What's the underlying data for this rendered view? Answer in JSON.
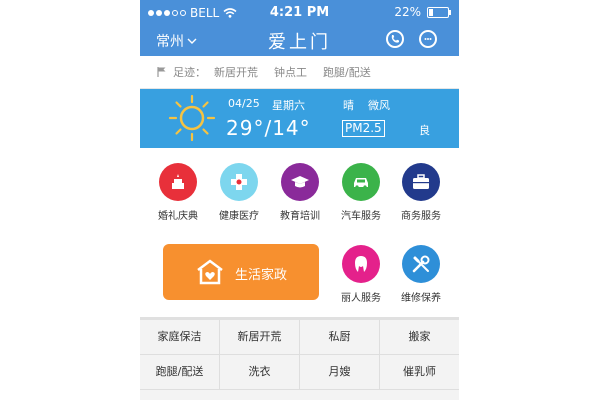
{
  "status": {
    "carrier": "BELL",
    "time": "4:21 PM",
    "battery": "22%",
    "battery_level": 0.22
  },
  "header": {
    "city": "常州",
    "title": "爱上门",
    "phone_icon": "phone-icon",
    "chat_icon": "chat-bubble-icon"
  },
  "footprints": {
    "label": "足迹：",
    "items": [
      "新居开荒",
      "钟点工",
      "跑腿/配送"
    ]
  },
  "weather": {
    "date": "04/25",
    "weekday": "星期六",
    "condition": "晴",
    "wind": "微风",
    "temperature": "29°/14°",
    "pm_label": "PM2.5",
    "air_quality": "良",
    "icon": "sun-icon"
  },
  "categories": [
    {
      "label": "婚礼庆典",
      "icon": "wedding-cake-icon",
      "color": "#e8303a"
    },
    {
      "label": "健康医疗",
      "icon": "medical-cross-icon",
      "color": "#7dd6ee"
    },
    {
      "label": "教育培训",
      "icon": "graduation-cap-icon",
      "color": "#8a2a9a"
    },
    {
      "label": "汽车服务",
      "icon": "car-icon",
      "color": "#3bb34a"
    },
    {
      "label": "商务服务",
      "icon": "briefcase-icon",
      "color": "#223a8c"
    },
    {
      "label": "丽人服务",
      "icon": "beauty-woman-icon",
      "color": "#e4218b"
    },
    {
      "label": "维修保养",
      "icon": "wrench-screwdriver-icon",
      "color": "#2e8fd8"
    }
  ],
  "life_banner": {
    "label": "生活家政",
    "icon": "home-heart-icon",
    "color": "#f7902f"
  },
  "services": [
    [
      "家庭保洁",
      "新居开荒",
      "私厨",
      "搬家"
    ],
    [
      "跑腿/配送",
      "洗衣",
      "月嫂",
      "催乳师"
    ]
  ],
  "colors": {
    "header": "#4a90d9",
    "weather": "#38a0e0",
    "sun": "#f6c342"
  }
}
